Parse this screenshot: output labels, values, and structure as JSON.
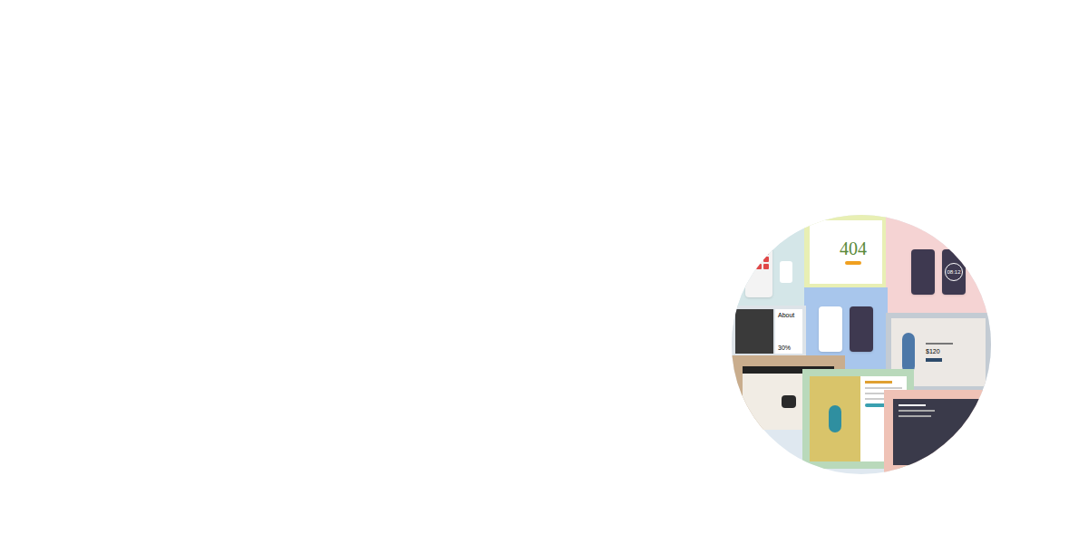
{
  "hero": {
    "collage": {
      "tiles": [
        {
          "kind": "phone-home",
          "color": "#d4e6e8"
        },
        {
          "kind": "error-page",
          "color": "#e8efb4",
          "text": "404"
        },
        {
          "kind": "clock-app",
          "color": "#f5d3d3",
          "text": "08:12"
        },
        {
          "kind": "weather-app",
          "color": "#a8c6ec"
        },
        {
          "kind": "profile",
          "color": "#dde3e8",
          "text": "About",
          "reading": "30%"
        },
        {
          "kind": "product",
          "color": "#c3cbd3",
          "text": "$120"
        },
        {
          "kind": "cosmetics",
          "color": "#c9ad8d"
        },
        {
          "kind": "signup",
          "color": "#b9d9bb"
        },
        {
          "kind": "dashboard",
          "color": "#efc2b6"
        }
      ]
    }
  }
}
